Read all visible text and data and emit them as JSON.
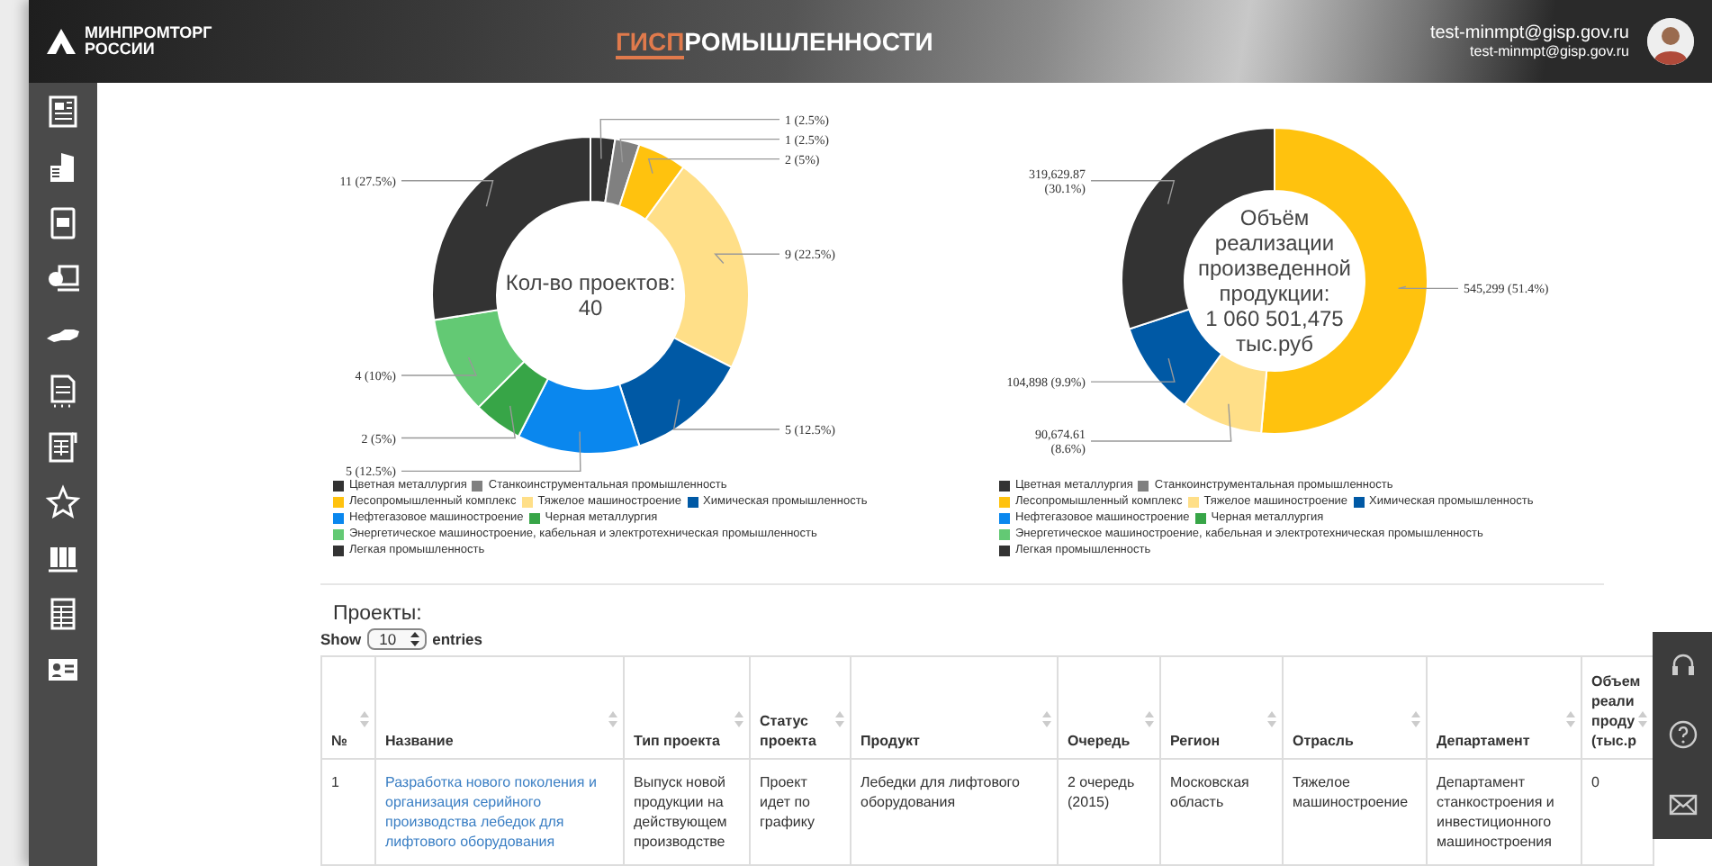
{
  "header": {
    "logo_lines": [
      "МИНПРОМТОРГ",
      "РОССИИ"
    ],
    "title_highlight": "ГИСП",
    "title_rest": "РОМЫШЛЕННОСТИ",
    "user_name": "test-minmpt@gisp.gov.ru",
    "user_email": "test-minmpt@gisp.gov.ru"
  },
  "charts": [
    {
      "center_lines": [
        "Кол-во проектов:",
        "40"
      ],
      "chart_data": {
        "type": "donut",
        "categories": [
          "Цветная металлургия",
          "Станкоинструментальная промышленность",
          "Лесопромышленный комплекс",
          "Тяжелое машиностроение",
          "Химическая промышленность",
          "Нефтегазовое машиностроение",
          "Черная металлургия",
          "Энергетическое машиностроение, кабельная и электротехническая промышленность",
          "Легкая промышленность"
        ],
        "colors": [
          "#333333",
          "#808080",
          "#ffc20e",
          "#ffdf88",
          "#0059a5",
          "#0a87ee",
          "#37a547",
          "#63c974",
          "#333333"
        ],
        "series": [
          {
            "values": [
              2.5,
              2.5,
              5,
              22.5,
              12.5,
              12.5,
              5,
              10,
              27.5
            ]
          }
        ],
        "value_labels": [
          "1 (2.5%)",
          "1 (2.5%)",
          "2 (5%)",
          "9 (22.5%)",
          "5 (12.5%)",
          "5 (12.5%)",
          "2 (5%)",
          "4 (10%)",
          "11 (27.5%)"
        ]
      }
    },
    {
      "center_lines": [
        "Объём",
        "реализации",
        "произведенной",
        "продукции:",
        "1 060 501,475",
        "тыс.руб"
      ],
      "chart_data": {
        "type": "donut",
        "categories": [
          "Цветная металлургия",
          "Станкоинструментальная промышленность",
          "Лесопромышленный комплекс",
          "Тяжелое машиностроение",
          "Химическая промышленность",
          "Нефтегазовое машиностроение",
          "Черная металлургия",
          "Энергетическое машиностроение, кабельная и электротехническая промышленность",
          "Легкая промышленность"
        ],
        "colors": [
          "#333333",
          "#808080",
          "#ffc20e",
          "#ffdf88",
          "#0059a5",
          "#0a87ee",
          "#37a547",
          "#63c974",
          "#333333"
        ],
        "series": [
          {
            "values": [
              0,
              0,
              51.4,
              8.6,
              9.9,
              0,
              0,
              0,
              30.1
            ]
          }
        ],
        "value_labels": [
          null,
          null,
          "545,299 (51.4%)",
          "90,674.61\n(8.6%)",
          "104,898 (9.9%)",
          null,
          null,
          null,
          "319,629.87\n(30.1%)"
        ]
      }
    }
  ],
  "projects": {
    "title": "Проекты:",
    "show_label": "Show",
    "page_size": "10",
    "entries_label": "entries",
    "columns": [
      "№",
      "Название",
      "Тип проекта",
      "Статус проекта",
      "Продукт",
      "Очередь",
      "Регион",
      "Отрасль",
      "Департамент",
      "Объем реали проду (тыс.р"
    ],
    "rows": [
      {
        "cells": [
          "1",
          "Разработка нового поколения и организация серийного производства лебедок для лифтового оборудования",
          "Выпуск новой продукции на действующем производстве",
          "Проект идет по графику",
          "Лебедки для лифтового оборудования",
          "2 очередь (2015)",
          "Московская область",
          "Тяжелое машиностроение",
          "Департамент станкостроения и инвестиционного машиностроения",
          "0"
        ]
      }
    ]
  }
}
